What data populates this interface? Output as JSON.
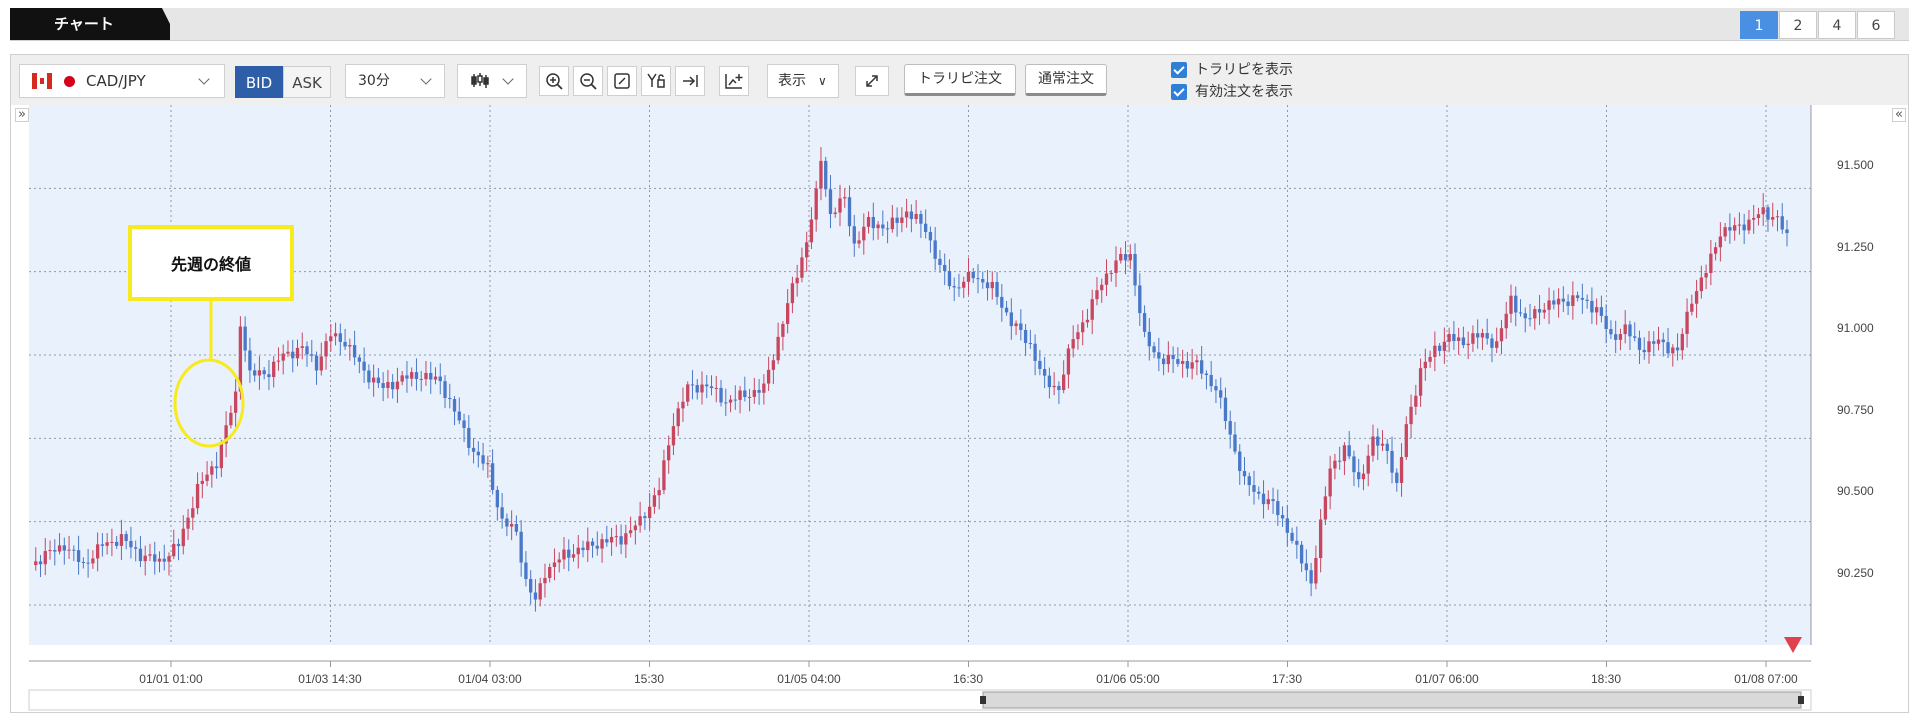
{
  "header": {
    "title": "チャート",
    "layouts": [
      "1",
      "2",
      "4",
      "6"
    ],
    "active_layout": "1"
  },
  "toolbar": {
    "symbol": "CAD/JPY",
    "bid_label": "BID",
    "ask_label": "ASK",
    "timeframe": "30分",
    "display_label": "表示",
    "trailing_order_label": "トラリピ注文",
    "normal_order_label": "通常注文",
    "show_trailing_label": "トラリピを表示",
    "show_orders_label": "有効注文を表示"
  },
  "annotation": {
    "text": "先週の終値"
  },
  "colors": {
    "up": "#c8475f",
    "down": "#4a78c8",
    "plot_bg": "#e9f1fd",
    "accent": "#2f5ea9",
    "highlight": "#f7ea1e"
  },
  "chart_data": {
    "type": "candlestick",
    "x_labels": [
      "01/01 01:00",
      "01/03 14:30",
      "01/04 03:00",
      "15:30",
      "01/05 04:00",
      "16:30",
      "01/06 05:00",
      "17:30",
      "01/07 06:00",
      "18:30",
      "01/08 07:00"
    ],
    "y_ticks": [
      "91.500",
      "91.250",
      "91.000",
      "90.750",
      "90.500",
      "90.250"
    ],
    "y_range": [
      90.13,
      91.75
    ],
    "close_path": [
      [
        0,
        90.37
      ],
      [
        3,
        90.4
      ],
      [
        7,
        90.43
      ],
      [
        11,
        90.37
      ],
      [
        15,
        90.43
      ],
      [
        19,
        90.45
      ],
      [
        23,
        90.4
      ],
      [
        27,
        90.38
      ],
      [
        31,
        90.43
      ],
      [
        35,
        90.6
      ],
      [
        39,
        90.68
      ],
      [
        43,
        90.88
      ],
      [
        44,
        91.1
      ],
      [
        46,
        90.94
      ],
      [
        50,
        90.95
      ],
      [
        53,
        91.0
      ],
      [
        57,
        91.02
      ],
      [
        60,
        90.97
      ],
      [
        63,
        91.06
      ],
      [
        66,
        91.04
      ],
      [
        70,
        90.95
      ],
      [
        74,
        90.9
      ],
      [
        78,
        90.93
      ],
      [
        82,
        90.94
      ],
      [
        86,
        90.92
      ],
      [
        90,
        90.8
      ],
      [
        93,
        90.71
      ],
      [
        96,
        90.66
      ],
      [
        99,
        90.5
      ],
      [
        102,
        90.47
      ],
      [
        104,
        90.32
      ],
      [
        106,
        90.26
      ],
      [
        108,
        90.35
      ],
      [
        112,
        90.4
      ],
      [
        116,
        90.42
      ],
      [
        120,
        90.44
      ],
      [
        124,
        90.45
      ],
      [
        128,
        90.5
      ],
      [
        132,
        90.6
      ],
      [
        135,
        90.8
      ],
      [
        138,
        90.9
      ],
      [
        142,
        90.91
      ],
      [
        146,
        90.86
      ],
      [
        150,
        90.88
      ],
      [
        154,
        90.9
      ],
      [
        157,
        91.05
      ],
      [
        160,
        91.2
      ],
      [
        163,
        91.34
      ],
      [
        165,
        91.48
      ],
      [
        166,
        91.59
      ],
      [
        168,
        91.42
      ],
      [
        171,
        91.47
      ],
      [
        173,
        91.33
      ],
      [
        176,
        91.4
      ],
      [
        180,
        91.38
      ],
      [
        184,
        91.43
      ],
      [
        188,
        91.38
      ],
      [
        191,
        91.26
      ],
      [
        194,
        91.2
      ],
      [
        198,
        91.24
      ],
      [
        202,
        91.2
      ],
      [
        206,
        91.1
      ],
      [
        210,
        91.03
      ],
      [
        213,
        90.92
      ],
      [
        216,
        90.9
      ],
      [
        219,
        91.05
      ],
      [
        222,
        91.12
      ],
      [
        225,
        91.22
      ],
      [
        228,
        91.28
      ],
      [
        231,
        91.3
      ],
      [
        234,
        91.05
      ],
      [
        237,
        90.99
      ],
      [
        241,
        90.98
      ],
      [
        245,
        90.97
      ],
      [
        249,
        90.9
      ],
      [
        252,
        90.76
      ],
      [
        255,
        90.62
      ],
      [
        258,
        90.58
      ],
      [
        261,
        90.55
      ],
      [
        264,
        90.48
      ],
      [
        267,
        90.38
      ],
      [
        269,
        90.32
      ],
      [
        271,
        90.49
      ],
      [
        273,
        90.66
      ],
      [
        276,
        90.72
      ],
      [
        279,
        90.62
      ],
      [
        282,
        90.74
      ],
      [
        285,
        90.72
      ],
      [
        287,
        90.6
      ],
      [
        289,
        90.79
      ],
      [
        292,
        90.95
      ],
      [
        295,
        91.02
      ],
      [
        298,
        91.05
      ],
      [
        301,
        91.04
      ],
      [
        305,
        91.06
      ],
      [
        308,
        91.03
      ],
      [
        311,
        91.17
      ],
      [
        314,
        91.1
      ],
      [
        317,
        91.14
      ],
      [
        321,
        91.16
      ],
      [
        325,
        91.17
      ],
      [
        329,
        91.14
      ],
      [
        332,
        91.05
      ],
      [
        335,
        91.08
      ],
      [
        338,
        91.02
      ],
      [
        342,
        91.04
      ],
      [
        346,
        91.01
      ],
      [
        349,
        91.17
      ],
      [
        352,
        91.25
      ],
      [
        355,
        91.37
      ],
      [
        358,
        91.38
      ],
      [
        361,
        91.4
      ],
      [
        364,
        91.43
      ],
      [
        367,
        91.41
      ],
      [
        369,
        91.35
      ]
    ],
    "candle_count": 370
  }
}
